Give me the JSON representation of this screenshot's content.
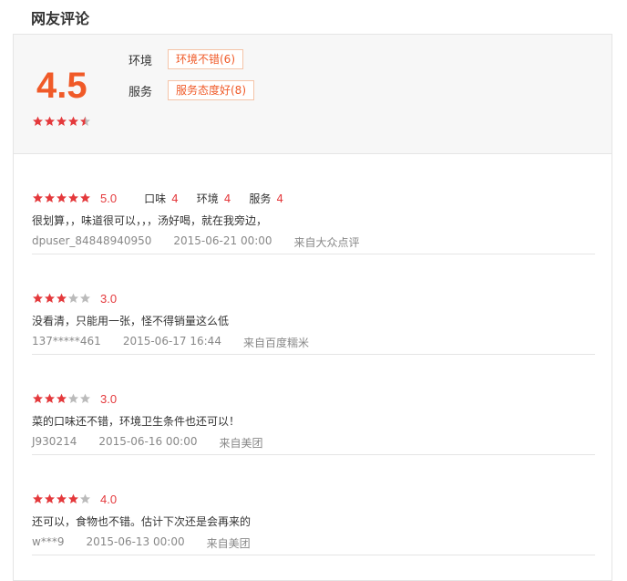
{
  "page": {
    "title": "网友评论"
  },
  "summary": {
    "score": "4.5",
    "rating": 4.5,
    "tags": [
      {
        "label": "环境",
        "value": "环境不错(6)"
      },
      {
        "label": "服务",
        "value": "服务态度好(8)"
      }
    ]
  },
  "reviews": [
    {
      "rating": 5,
      "score": "5.0",
      "sub_scores": [
        {
          "label": "口味",
          "value": "4"
        },
        {
          "label": "环境",
          "value": "4"
        },
        {
          "label": "服务",
          "value": "4"
        }
      ],
      "text": "很划算，，味道很可以，，，汤好喝，就在我旁边，",
      "user": "dpuser_84848940950",
      "date": "2015-06-21 00:00",
      "source": "来自大众点评"
    },
    {
      "rating": 3,
      "score": "3.0",
      "text": "没看清，只能用一张，怪不得销量这么低",
      "user": "137*****461",
      "date": "2015-06-17 16:44",
      "source": "来自百度糯米"
    },
    {
      "rating": 3,
      "score": "3.0",
      "text": "菜的口味还不错，环境卫生条件也还可以！",
      "user": "J930214",
      "date": "2015-06-16 00:00",
      "source": "来自美团"
    },
    {
      "rating": 4,
      "score": "4.0",
      "text": "还可以，食物也不错。估计下次还是会再来的",
      "user": "w***9",
      "date": "2015-06-13 00:00",
      "source": "来自美团"
    }
  ],
  "colors": {
    "accent": "#f05a28",
    "star_on": "#e4393c",
    "star_off": "#bbbbbb"
  }
}
